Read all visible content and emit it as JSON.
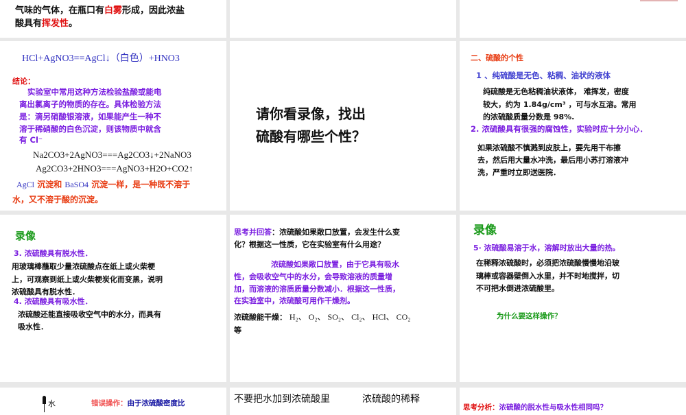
{
  "slides": [
    {
      "lines": [
        "气味的气体，在瓶口有",
        "白雾",
        "形成，因此浓盐",
        "酸具有",
        "挥发性",
        "。"
      ]
    },
    {},
    {},
    {
      "equation1": "HCl+AgNO3==AgCl↓（白色）+HNO3",
      "conclusion_label": "结论：",
      "conclusion": [
        "实验室中常用这种方法检验盐酸或能电",
        "离出氯离子的物质的存在。具体检验方法",
        "是：滴另硝酸银溶液，如果能产生一种不",
        "溶于稀硝酸的白色沉淀，则该物质中就含",
        "有 Cl⁻"
      ],
      "equation2": "Na2CO3+2AgNO3===Ag2CO3↓+2NaNO3",
      "equation3": "Ag2CO3+2HNO3===AgNO3+H2O+CO2↑",
      "note_line1_a": "AgCl",
      "note_line1_b": " 沉淀和 ",
      "note_line1_c": "BaSO4",
      "note_line1_d": " 沉淀一样，是一种既不溶于",
      "note_line2": "水，又不溶于酸的沉淀。"
    },
    {
      "title": [
        "请你看录像，找出",
        "硫酸有哪些个性？"
      ]
    },
    {
      "heading": "二、硫酸的个性",
      "point1": "1 、纯硫酸是无色、粘稠、油状的液体",
      "text1": [
        "纯硫酸是无色粘稠油状液体， 难挥发，密度",
        "较大，约为 1.84g/cm³ ，可与水互溶。常用",
        "的浓硫酸质量分数是 98%."
      ],
      "point2": "2. 浓硫酸具有很强的腐蚀性，实验时应十分小心．",
      "text2": [
        "如果浓硫酸不慎溅到皮肤上，要先用干布擦",
        "去，然后用大量水冲洗，最后用小苏打溶液冲",
        "洗，严重时立即送医院．"
      ]
    },
    {
      "video": "录像",
      "point3": "3. 浓硫酸具有脱水性．",
      "text3": [
        "用玻璃棒蘸取少量浓硫酸点在纸上或火柴梗",
        "上，可观察到纸上或火柴梗炭化而变黑，说明",
        "浓硫酸具有脱水性．"
      ],
      "point4": "4. 浓硫酸具有吸水性．",
      "text4": [
        "浓硫酸还能直接吸收空气中的水分，而具有",
        "吸水性．"
      ]
    },
    {
      "question_label": "思考并回答",
      "question": [
        "：浓硫酸如果敞口放置，会发生什么变",
        "化？根据这一性质，它在实验室有什么用途？"
      ],
      "answer": [
        "浓硫酸如果敞口放置，由于它具有吸水",
        "性，会吸收空气中的水分，会导致溶液的质量增",
        "加，而溶液的溶质质量分数减小．根据这一性质，",
        "在实验室中，浓硫酸可用作干燥剂。"
      ],
      "dry_label": "浓硫酸能干燥：",
      "dry_list": "H₂、 O₂、 SO₂、 Cl₂、 HCl、 CO₂",
      "dry_end": "等"
    },
    {
      "video": "录像",
      "point5": "5· 浓硫酸易溶于水，溶解时放出大量的热。",
      "text5": [
        "在稀释浓硫酸时，必须把浓硫酸慢慢地沿玻",
        "璃棒或容器壁倒入水里，并不时地搅拌，切",
        "不可把水倒进浓硫酸里。"
      ],
      "why": "为什么要这样操作？"
    },
    {
      "water": "水",
      "wrong_label": "错误操作：",
      "wrong_text": "由于浓硫酸密度比"
    },
    {
      "caption1": "不要把水加到浓硫酸里",
      "caption2": "浓硫酸的稀释"
    },
    {
      "label": "思考分析：",
      "text": "浓硫酸的脱水性与吸水性相同吗？"
    }
  ]
}
